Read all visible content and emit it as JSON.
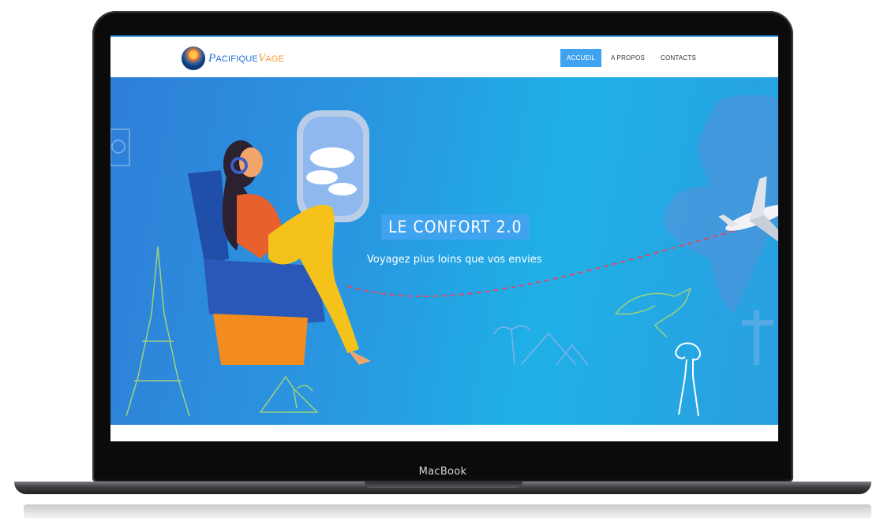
{
  "device": {
    "label": "MacBook"
  },
  "header": {
    "logo": {
      "text_main": "ACIFIQUE",
      "text_accent": "AGE",
      "icon": "palm-beach-logo-icon"
    },
    "nav": [
      {
        "label": "ACCUEIL",
        "active": true
      },
      {
        "label": "A PROPOS",
        "active": false
      },
      {
        "label": "CONTACTS",
        "active": false
      }
    ]
  },
  "hero": {
    "title": "LE CONFORT 2.0",
    "subtitle": "Voyagez plus loins que vos envies",
    "illustration": "woman-in-airplane-seat",
    "decor_icons": [
      "camera-icon",
      "eiffel-tower-icon",
      "volcano-palm-icon",
      "pyramids-palm-icon",
      "kangaroo-icon",
      "christ-statue-icon",
      "world-map-icon",
      "airplane-icon"
    ]
  },
  "colors": {
    "accent": "#3fa3f0",
    "hero_start": "#2f7fd8",
    "hero_end": "#1fb0e6"
  }
}
